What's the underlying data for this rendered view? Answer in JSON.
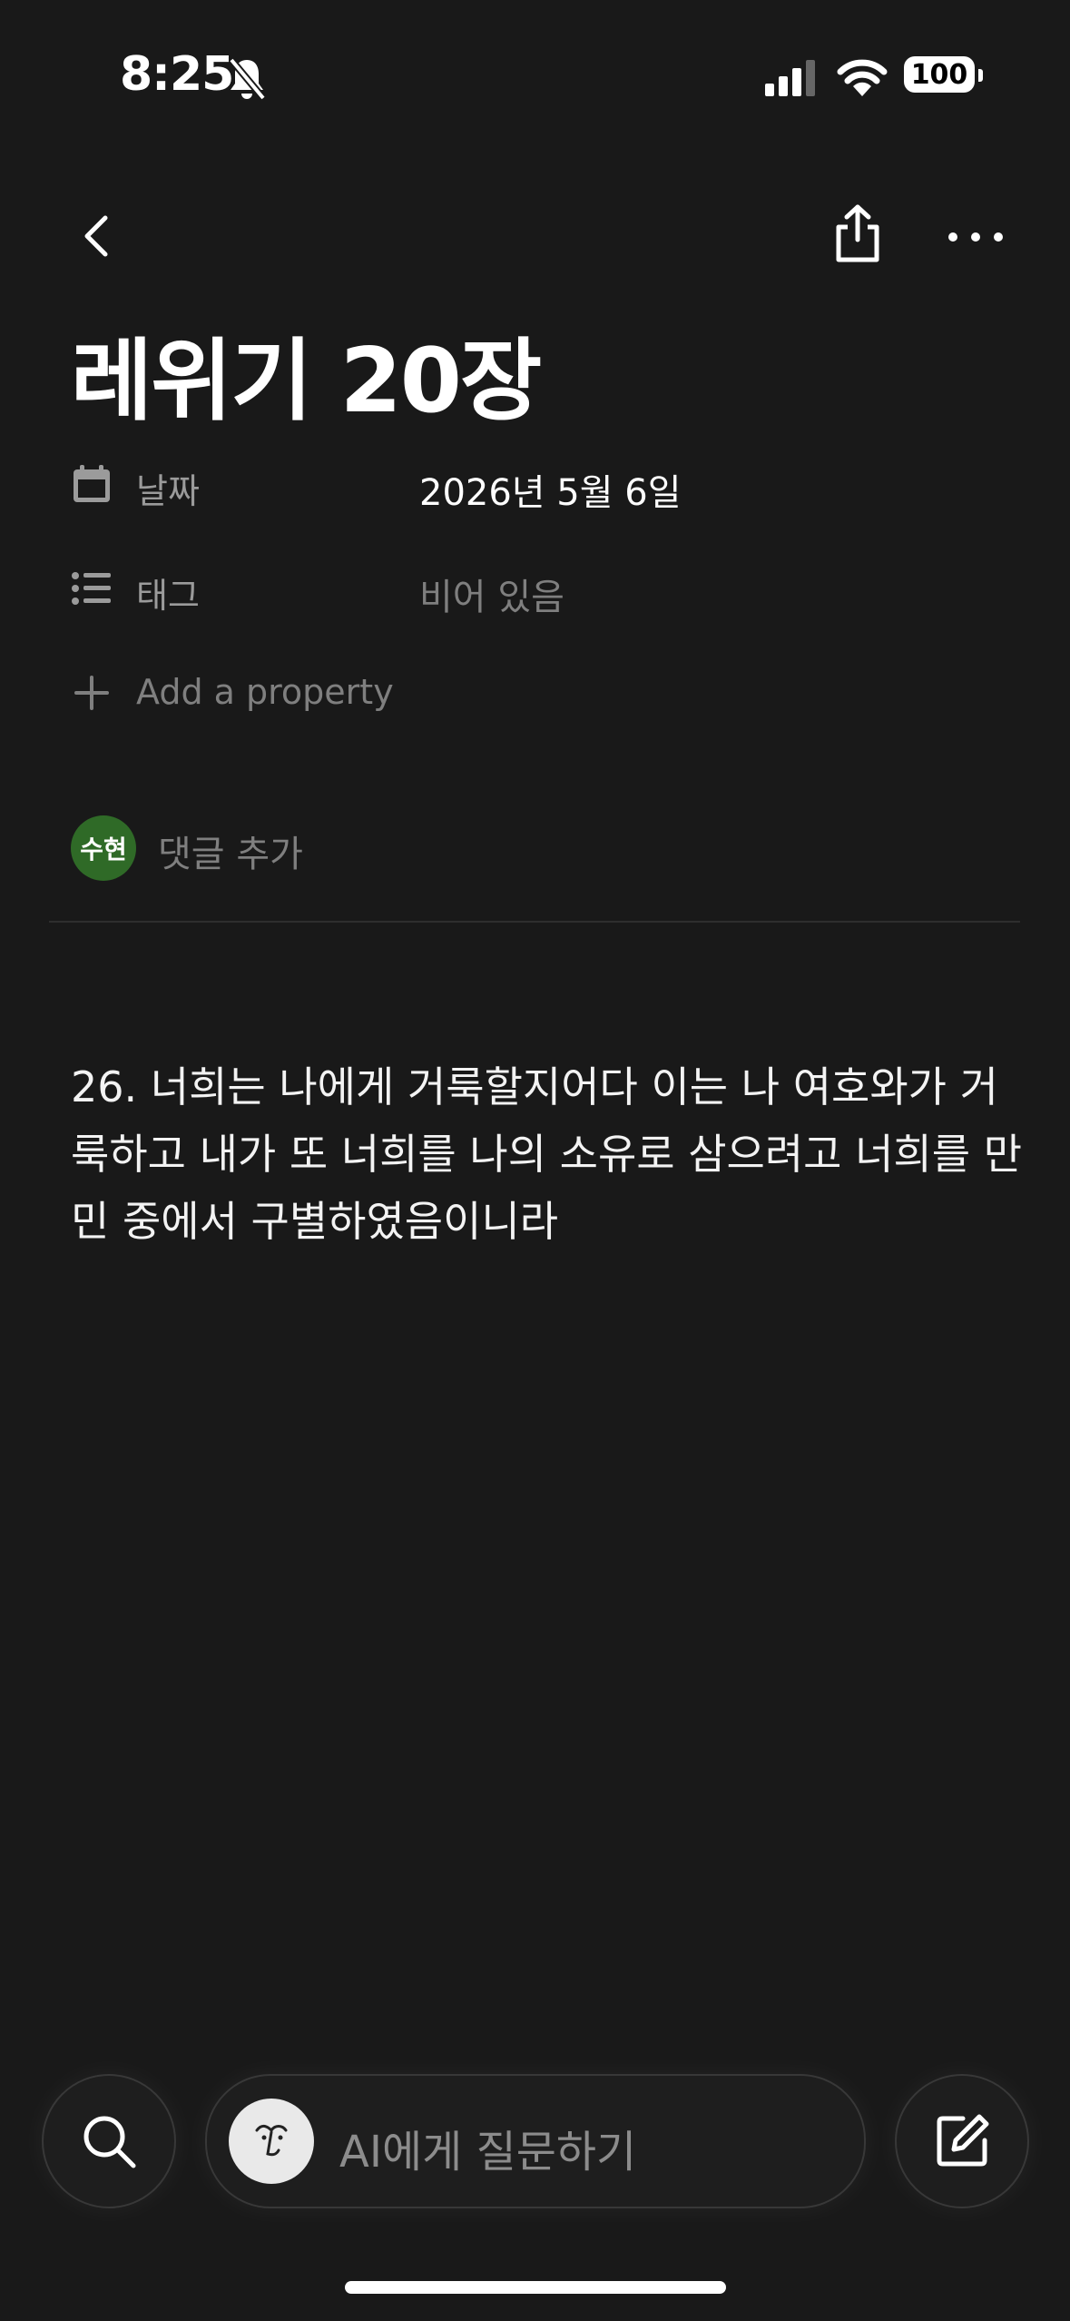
{
  "status_bar": {
    "time": "8:25",
    "battery": "100"
  },
  "page": {
    "title": "레위기 20장",
    "properties": [
      {
        "label": "날짜",
        "value": "2026년 5월 6일",
        "icon": "calendar-icon"
      },
      {
        "label": "태그",
        "value": "비어 있음",
        "icon": "list-icon"
      }
    ],
    "add_property": "Add a property",
    "comment": {
      "avatar": "수현",
      "placeholder": "댓글 추가"
    },
    "body_text": "26. 너희는 나에게 거룩할지어다 이는 나 여호와가 거룩하고 내가 또 너희를 나의 소유로 삼으려고 너희를 만민 중에서 구별하였음이니라"
  },
  "bottom_bar": {
    "ai_placeholder": "AI에게 질문하기"
  },
  "colors": {
    "background": "#191919",
    "avatar": "#2f6a27",
    "muted": "#7f7f7f"
  }
}
